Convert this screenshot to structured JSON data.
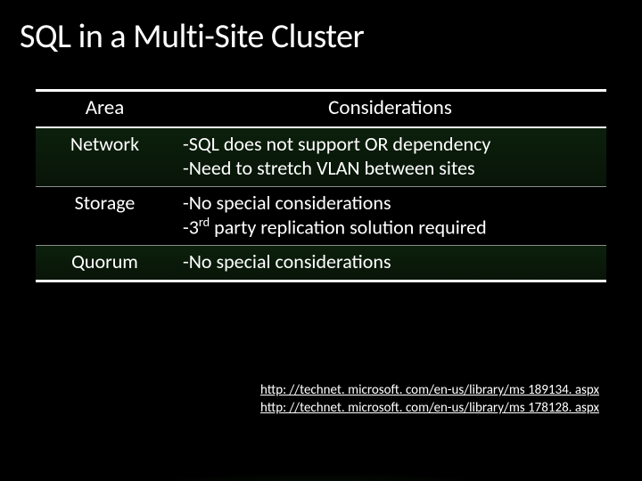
{
  "title": "SQL in a Multi-Site Cluster",
  "table": {
    "headers": {
      "area": "Area",
      "considerations": "Considerations"
    },
    "rows": [
      {
        "area": "Network",
        "considerations": "-SQL does not support OR dependency\n-Need to stretch VLAN between sites"
      },
      {
        "area": "Storage",
        "considerations_html": "-No special considerations\n-3<sup class=\"sup\">rd</sup> party replication solution required"
      },
      {
        "area": "Quorum",
        "considerations": "-No special considerations"
      }
    ]
  },
  "links": [
    "http: //technet. microsoft. com/en-us/library/ms 189134. aspx",
    "http: //technet. microsoft. com/en-us/library/ms 178128. aspx"
  ]
}
